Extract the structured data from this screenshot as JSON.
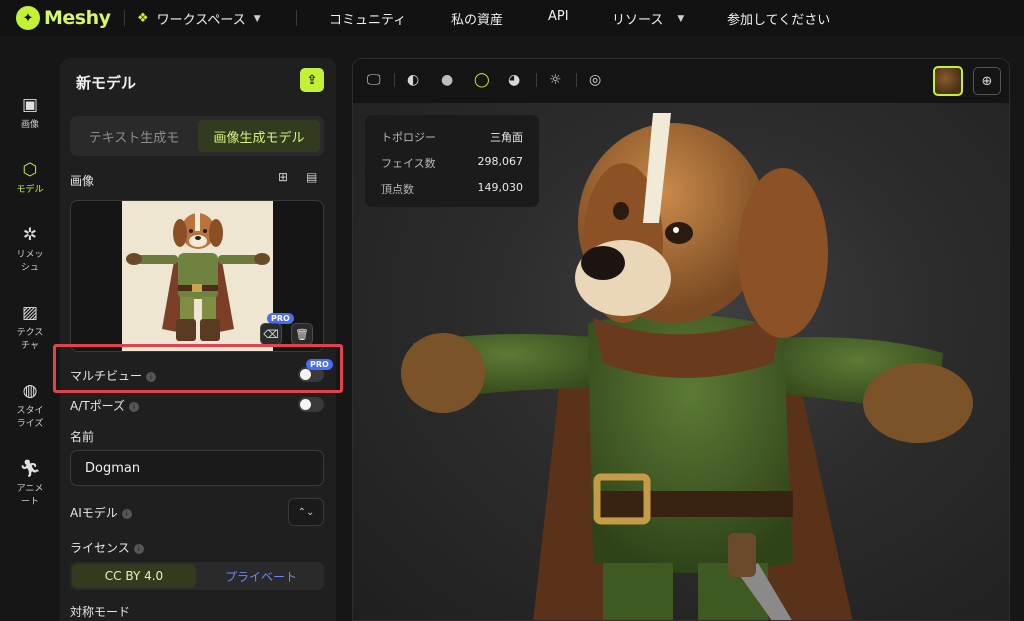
{
  "brand": {
    "name": "Meshy"
  },
  "nav": {
    "workspace": "ワークスペース",
    "community": "コミュニティ",
    "assets": "私の資産",
    "api": "API",
    "resources": "リソース",
    "join": "参加してください"
  },
  "rail": [
    {
      "label": "画像",
      "icon": "image-ai-icon"
    },
    {
      "label": "モデル",
      "icon": "cube-icon",
      "active": true
    },
    {
      "label": "リメッシュ",
      "icon": "remesh-icon"
    },
    {
      "label": "テクスチャ",
      "icon": "texture-icon"
    },
    {
      "label": "スタイライズ",
      "icon": "stylize-icon"
    },
    {
      "label": "アニメート",
      "icon": "running-figure-icon"
    }
  ],
  "panel": {
    "title": "新モデル",
    "tab_text": "テキスト生成モ",
    "tab_image": "画像生成モデル",
    "image_label": "画像",
    "pro_badge": "PRO",
    "multiview_label": "マルチビュー",
    "multiview_pro": "PRO",
    "multiview_enabled": false,
    "atpose_label": "A/Tポーズ",
    "atpose_enabled": false,
    "name_label": "名前",
    "name_value": "Dogman",
    "ai_model_label": "AIモデル",
    "license_label": "ライセンス",
    "license_cc": "CC BY 4.0",
    "license_private": "プライベート",
    "symmetry_label": "対称モード"
  },
  "viewer": {
    "stats": [
      {
        "key": "トポロジー",
        "value": "三角面"
      },
      {
        "key": "フェイス数",
        "value": "298,067"
      },
      {
        "key": "頂点数",
        "value": "149,030"
      }
    ]
  },
  "colors": {
    "accent": "#c4f135",
    "highlight": "#e0424f",
    "pro": "#4a6cf0"
  }
}
